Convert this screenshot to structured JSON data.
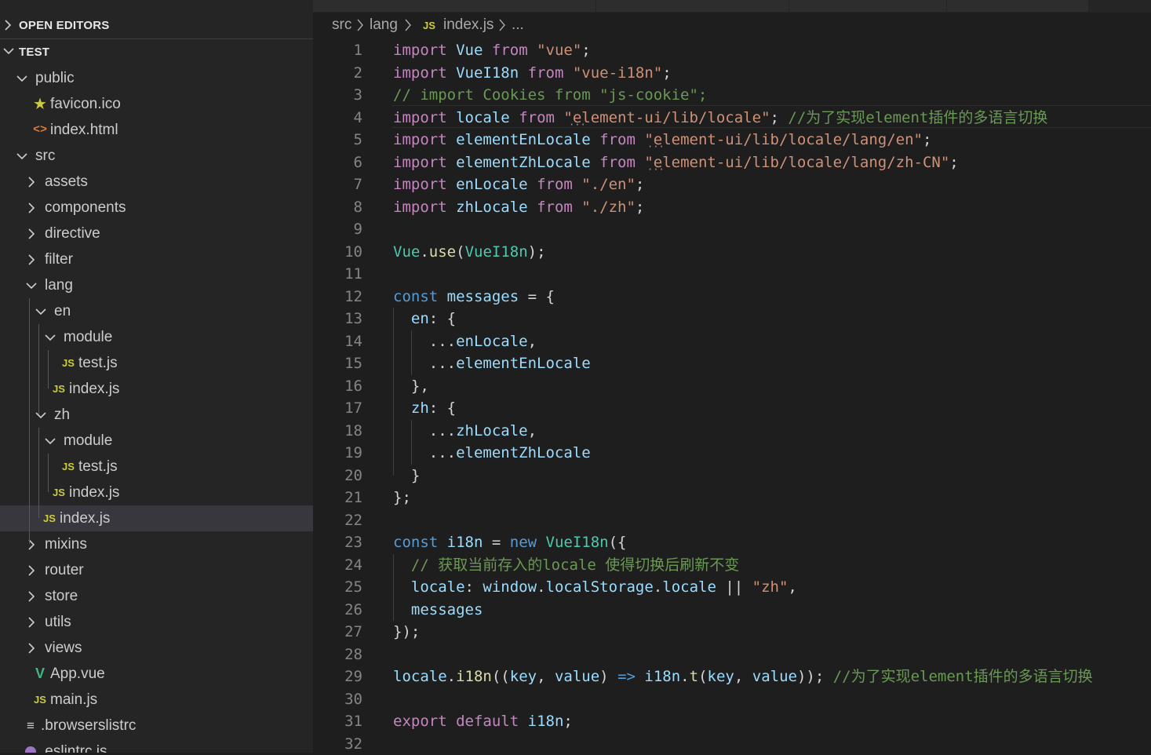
{
  "explorer": {
    "open_editors_label": "OPEN EDITORS",
    "workspace_label": "TEST",
    "tree": [
      {
        "label": "public",
        "kind": "folder-open"
      },
      {
        "label": "favicon.ico",
        "kind": "star"
      },
      {
        "label": "index.html",
        "kind": "html"
      },
      {
        "label": "src",
        "kind": "folder-open"
      },
      {
        "label": "assets",
        "kind": "folder-closed"
      },
      {
        "label": "components",
        "kind": "folder-closed"
      },
      {
        "label": "directive",
        "kind": "folder-closed"
      },
      {
        "label": "filter",
        "kind": "folder-closed"
      },
      {
        "label": "lang",
        "kind": "folder-open"
      },
      {
        "label": "en",
        "kind": "folder-open"
      },
      {
        "label": "module",
        "kind": "folder-open"
      },
      {
        "label": "test.js",
        "kind": "js"
      },
      {
        "label": "index.js",
        "kind": "js"
      },
      {
        "label": "zh",
        "kind": "folder-open"
      },
      {
        "label": "module",
        "kind": "folder-open"
      },
      {
        "label": "test.js",
        "kind": "js"
      },
      {
        "label": "index.js",
        "kind": "js"
      },
      {
        "label": "index.js",
        "kind": "js",
        "selected": true
      },
      {
        "label": "mixins",
        "kind": "folder-closed"
      },
      {
        "label": "router",
        "kind": "folder-closed"
      },
      {
        "label": "store",
        "kind": "folder-closed"
      },
      {
        "label": "utils",
        "kind": "folder-closed"
      },
      {
        "label": "views",
        "kind": "folder-closed"
      },
      {
        "label": "App.vue",
        "kind": "vue"
      },
      {
        "label": "main.js",
        "kind": "js"
      },
      {
        "label": ".browserslistrc",
        "kind": "list"
      },
      {
        "label": ".eslintrc.js",
        "kind": "eslint"
      }
    ]
  },
  "icons": {
    "js": "JS",
    "html": "<>",
    "star": "★",
    "vue": "V",
    "list": "≡"
  },
  "breadcrumb": {
    "parts": [
      "src",
      "lang",
      "index.js",
      "..."
    ]
  },
  "editor": {
    "line_numbers": [
      "1",
      "2",
      "3",
      "4",
      "5",
      "6",
      "7",
      "8",
      "9",
      "10",
      "11",
      "12",
      "13",
      "14",
      "15",
      "16",
      "17",
      "18",
      "19",
      "20",
      "21",
      "22",
      "23",
      "24",
      "25",
      "26",
      "27",
      "28",
      "29",
      "30",
      "31",
      "32"
    ],
    "lines": [
      [
        [
          "kc",
          "import"
        ],
        [
          "pn",
          " "
        ],
        [
          "vr",
          "Vue"
        ],
        [
          "pn",
          " "
        ],
        [
          "kc",
          "from"
        ],
        [
          "pn",
          " "
        ],
        [
          "str",
          "\"vue\""
        ],
        [
          "pn",
          ";"
        ]
      ],
      [
        [
          "kc",
          "import"
        ],
        [
          "pn",
          " "
        ],
        [
          "vr",
          "VueI18n"
        ],
        [
          "pn",
          " "
        ],
        [
          "kc",
          "from"
        ],
        [
          "pn",
          " "
        ],
        [
          "str",
          "\"vue-i18n\""
        ],
        [
          "pn",
          ";"
        ]
      ],
      [
        [
          "cm",
          "// import Cookies from \"js-cookie\";"
        ]
      ],
      [
        [
          "kc",
          "import"
        ],
        [
          "pn",
          " "
        ],
        [
          "vr",
          "locale"
        ],
        [
          "pn",
          " "
        ],
        [
          "kc",
          "from"
        ],
        [
          "pn",
          " "
        ],
        [
          "str",
          "\"element-ui/lib/locale\""
        ],
        [
          "pn",
          "; "
        ],
        [
          "cm",
          "//为了实现element插件的多语言切换"
        ]
      ],
      [
        [
          "kc",
          "import"
        ],
        [
          "pn",
          " "
        ],
        [
          "vr",
          "elementEnLocale"
        ],
        [
          "pn",
          " "
        ],
        [
          "kc",
          "from"
        ],
        [
          "pn",
          " "
        ],
        [
          "str",
          "\"element-ui/lib/locale/lang/en\""
        ],
        [
          "pn",
          ";"
        ]
      ],
      [
        [
          "kc",
          "import"
        ],
        [
          "pn",
          " "
        ],
        [
          "vr",
          "elementZhLocale"
        ],
        [
          "pn",
          " "
        ],
        [
          "kc",
          "from"
        ],
        [
          "pn",
          " "
        ],
        [
          "str",
          "\"element-ui/lib/locale/lang/zh-CN\""
        ],
        [
          "pn",
          ";"
        ]
      ],
      [
        [
          "kc",
          "import"
        ],
        [
          "pn",
          " "
        ],
        [
          "vr",
          "enLocale"
        ],
        [
          "pn",
          " "
        ],
        [
          "kc",
          "from"
        ],
        [
          "pn",
          " "
        ],
        [
          "str",
          "\"./en\""
        ],
        [
          "pn",
          ";"
        ]
      ],
      [
        [
          "kc",
          "import"
        ],
        [
          "pn",
          " "
        ],
        [
          "vr",
          "zhLocale"
        ],
        [
          "pn",
          " "
        ],
        [
          "kc",
          "from"
        ],
        [
          "pn",
          " "
        ],
        [
          "str",
          "\"./zh\""
        ],
        [
          "pn",
          ";"
        ]
      ],
      [],
      [
        [
          "cls",
          "Vue"
        ],
        [
          "pn",
          "."
        ],
        [
          "fn",
          "use"
        ],
        [
          "pn",
          "("
        ],
        [
          "cls",
          "VueI18n"
        ],
        [
          "pn",
          ");"
        ]
      ],
      [],
      [
        [
          "kw",
          "const"
        ],
        [
          "pn",
          " "
        ],
        [
          "vr",
          "messages"
        ],
        [
          "pn",
          " = {"
        ]
      ],
      [
        [
          "pn",
          "  "
        ],
        [
          "vr",
          "en"
        ],
        [
          "pn",
          ": {"
        ]
      ],
      [
        [
          "pn",
          "    ..."
        ],
        [
          "vr",
          "enLocale"
        ],
        [
          "pn",
          ","
        ]
      ],
      [
        [
          "pn",
          "    ..."
        ],
        [
          "vr",
          "elementEnLocale"
        ]
      ],
      [
        [
          "pn",
          "  },"
        ]
      ],
      [
        [
          "pn",
          "  "
        ],
        [
          "vr",
          "zh"
        ],
        [
          "pn",
          ": {"
        ]
      ],
      [
        [
          "pn",
          "    ..."
        ],
        [
          "vr",
          "zhLocale"
        ],
        [
          "pn",
          ","
        ]
      ],
      [
        [
          "pn",
          "    ..."
        ],
        [
          "vr",
          "elementZhLocale"
        ]
      ],
      [
        [
          "pn",
          "  }"
        ]
      ],
      [
        [
          "pn",
          "};"
        ]
      ],
      [],
      [
        [
          "kw",
          "const"
        ],
        [
          "pn",
          " "
        ],
        [
          "vr",
          "i18n"
        ],
        [
          "pn",
          " = "
        ],
        [
          "kw",
          "new"
        ],
        [
          "pn",
          " "
        ],
        [
          "cls",
          "VueI18n"
        ],
        [
          "pn",
          "({"
        ]
      ],
      [
        [
          "pn",
          "  "
        ],
        [
          "cm",
          "// 获取当前存入的locale 使得切换后刷新不变"
        ]
      ],
      [
        [
          "pn",
          "  "
        ],
        [
          "vr",
          "locale"
        ],
        [
          "pn",
          ": "
        ],
        [
          "vr",
          "window"
        ],
        [
          "pn",
          "."
        ],
        [
          "vr",
          "localStorage"
        ],
        [
          "pn",
          "."
        ],
        [
          "vr",
          "locale"
        ],
        [
          "pn",
          " || "
        ],
        [
          "str",
          "\"zh\""
        ],
        [
          "pn",
          ","
        ]
      ],
      [
        [
          "pn",
          "  "
        ],
        [
          "vr",
          "messages"
        ]
      ],
      [
        [
          "pn",
          "});"
        ]
      ],
      [],
      [
        [
          "vr",
          "locale"
        ],
        [
          "pn",
          "."
        ],
        [
          "fn",
          "i18n"
        ],
        [
          "pn",
          "(("
        ],
        [
          "vr",
          "key"
        ],
        [
          "pn",
          ", "
        ],
        [
          "vr",
          "value"
        ],
        [
          "pn",
          ") "
        ],
        [
          "kw",
          "=>"
        ],
        [
          "pn",
          " "
        ],
        [
          "vr",
          "i18n"
        ],
        [
          "pn",
          "."
        ],
        [
          "fn",
          "t"
        ],
        [
          "pn",
          "("
        ],
        [
          "vr",
          "key"
        ],
        [
          "pn",
          ", "
        ],
        [
          "vr",
          "value"
        ],
        [
          "pn",
          "));"
        ],
        [
          "pn",
          " "
        ],
        [
          "cm",
          "//为了实现element插件的多语言切换"
        ]
      ],
      [],
      [
        [
          "kc",
          "export"
        ],
        [
          "pn",
          " "
        ],
        [
          "kc",
          "default"
        ],
        [
          "pn",
          " "
        ],
        [
          "vr",
          "i18n"
        ],
        [
          "pn",
          ";"
        ]
      ],
      []
    ]
  }
}
